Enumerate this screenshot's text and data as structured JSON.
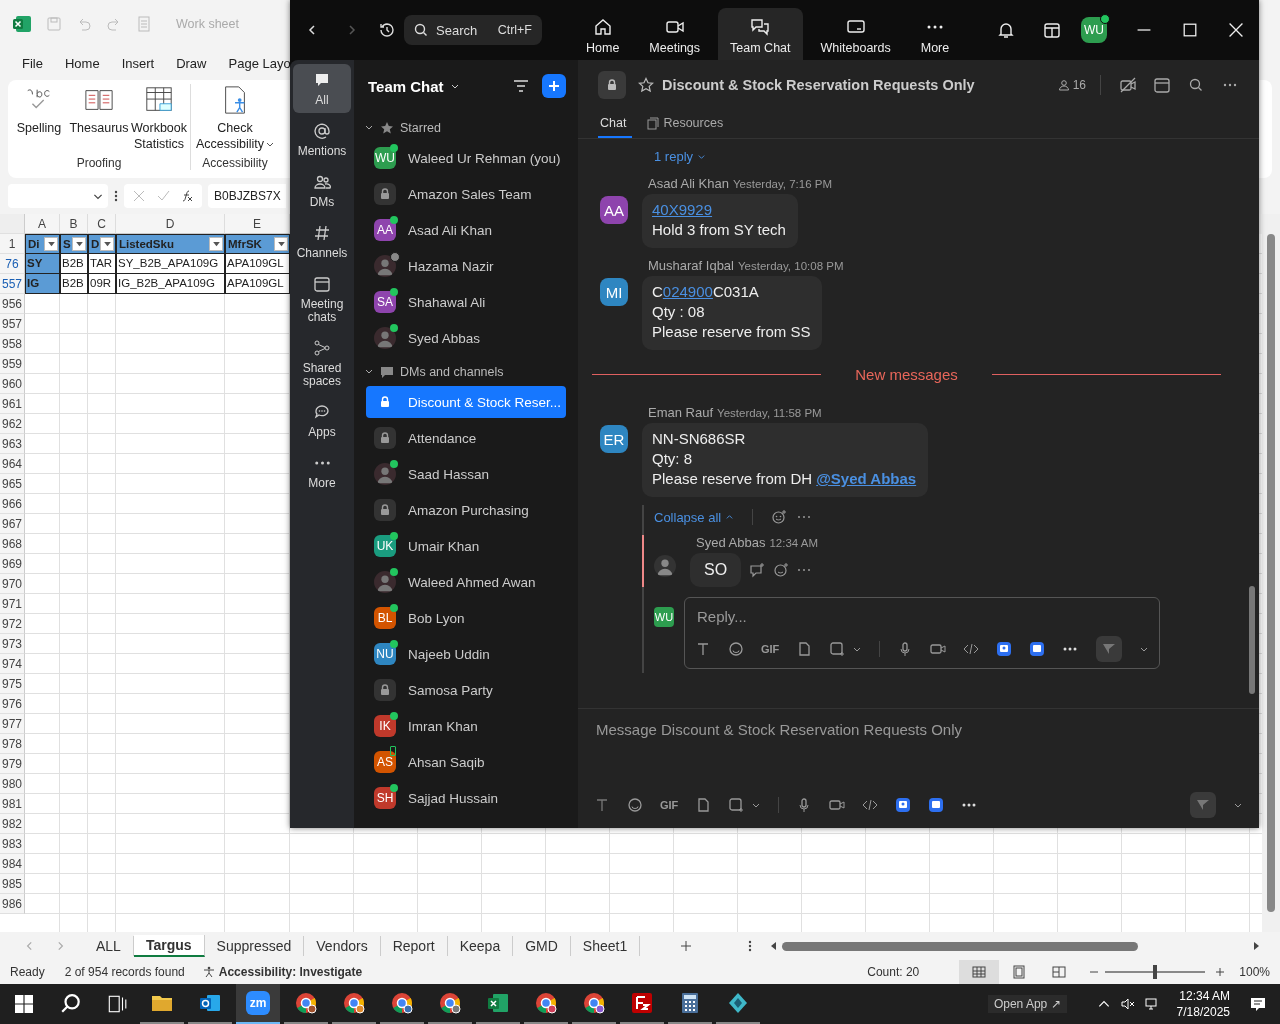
{
  "excel": {
    "title": "Work sheet",
    "menu": [
      "File",
      "Home",
      "Insert",
      "Draw",
      "Page Layo"
    ],
    "ribbon": [
      {
        "label": "Proofing",
        "buttons": [
          {
            "kind": "spelling",
            "label": "Spelling"
          },
          {
            "kind": "thesaurus",
            "label": "Thesaurus"
          },
          {
            "kind": "statistics",
            "label": "Workbook Statistics"
          }
        ]
      },
      {
        "label": "Accessibility",
        "buttons": [
          {
            "kind": "accessibility",
            "label": "Check Accessibility"
          }
        ]
      }
    ],
    "formula_value": "B0BJZBS7X",
    "columns": [
      "A",
      "B",
      "C",
      "D",
      "E"
    ],
    "header_row": {
      "number": "1",
      "cells": [
        "Di",
        "S",
        "D",
        "ListedSku",
        "MfrSK"
      ]
    },
    "rows": [
      {
        "number": "76",
        "cells": [
          "SY",
          "B2B",
          "TAR",
          "SY_B2B_APA109G",
          "APA109GL"
        ]
      },
      {
        "number": "557",
        "cells": [
          "IG",
          "B2B",
          "09R",
          "IG_B2B_APA109G",
          "APA109GL"
        ]
      }
    ],
    "empty_rows": [
      "956",
      "957",
      "958",
      "959",
      "960",
      "961",
      "962",
      "963",
      "964",
      "965",
      "966",
      "967",
      "968",
      "969",
      "970",
      "971",
      "972",
      "973",
      "974",
      "975",
      "976",
      "977",
      "978",
      "979",
      "980",
      "981",
      "982",
      "983",
      "984",
      "985",
      "986"
    ],
    "sheet_tabs": [
      {
        "label": "ALL",
        "selected": false
      },
      {
        "label": "Targus",
        "selected": true
      },
      {
        "label": "Suppressed",
        "selected": false
      },
      {
        "label": "Vendors",
        "selected": false
      },
      {
        "label": "Report",
        "selected": false
      },
      {
        "label": "Keepa",
        "selected": false
      },
      {
        "label": "GMD",
        "selected": false
      },
      {
        "label": "Sheet1",
        "selected": false
      }
    ],
    "status": {
      "ready": "Ready",
      "records": "2 of 954 records found",
      "accessibility": "Accessibility: Investigate",
      "count": "Count: 20",
      "zoom": "100%"
    },
    "zoom_slider": {
      "level": 0.5
    }
  },
  "taskbar": {
    "apps": [
      {
        "kind": "files",
        "selected": false
      },
      {
        "kind": "outlook",
        "selected": false
      },
      {
        "kind": "zoom",
        "label": "zm",
        "selected": true
      },
      {
        "kind": "browser",
        "color": "#a0522d",
        "selected": false
      },
      {
        "kind": "browser",
        "color": "#e08a2b",
        "selected": false
      },
      {
        "kind": "browser",
        "color": "#3a6fb0",
        "selected": false
      },
      {
        "kind": "browser",
        "color": "#7a7a7a",
        "selected": false
      },
      {
        "kind": "excel",
        "selected": false
      },
      {
        "kind": "browser",
        "color": "#d0405a",
        "selected": false
      },
      {
        "kind": "browser",
        "color": "#8a5ad0",
        "selected": false
      },
      {
        "kind": "filezilla",
        "selected": false
      },
      {
        "kind": "calculator",
        "selected": false
      },
      {
        "kind": "diamond",
        "selected": false
      }
    ],
    "open_app": "Open App ↗",
    "time": "12:34 AM",
    "date": "7/18/2025"
  },
  "zoom": {
    "search": {
      "placeholder": "Search",
      "shortcut": "Ctrl+F"
    },
    "nav": [
      {
        "kind": "home",
        "label": "Home",
        "selected": false
      },
      {
        "kind": "meetings",
        "label": "Meetings",
        "selected": false
      },
      {
        "kind": "chat",
        "label": "Team Chat",
        "selected": true
      },
      {
        "kind": "whiteboards",
        "label": "Whiteboards",
        "selected": false
      },
      {
        "kind": "more",
        "label": "More",
        "selected": false
      }
    ],
    "user_initials": "WU",
    "rail": [
      {
        "kind": "all",
        "label": "All",
        "selected": true
      },
      {
        "kind": "mentions",
        "label": "Mentions",
        "selected": false
      },
      {
        "kind": "dms",
        "label": "DMs",
        "selected": false
      },
      {
        "kind": "channels",
        "label": "Channels",
        "selected": false
      },
      {
        "kind": "meeting",
        "label": "Meeting chats",
        "selected": false
      },
      {
        "kind": "shared",
        "label": "Shared spaces",
        "selected": false
      },
      {
        "kind": "apps",
        "label": "Apps",
        "selected": false
      },
      {
        "kind": "more",
        "label": "More",
        "selected": false
      }
    ],
    "list_title": "Team Chat",
    "sections": [
      {
        "kind": "starred",
        "label": "Starred",
        "expanded": true,
        "items": [
          {
            "name": "Waleed Ur Rehman (you)",
            "kind": "initials",
            "initials": "WU",
            "color": "#2d9d4f",
            "status": {
              "kind": "online"
            },
            "selected": false
          },
          {
            "name": "Amazon Sales Team",
            "kind": "lock",
            "selected": false
          },
          {
            "name": "Asad Ali Khan",
            "kind": "initials",
            "initials": "AA",
            "color": "#8e44ad",
            "status": {
              "kind": "online"
            },
            "selected": false
          },
          {
            "name": "Hazama Nazir",
            "kind": "photo",
            "status": {
              "kind": "away"
            },
            "selected": false
          },
          {
            "name": "Shahawal Ali",
            "kind": "initials",
            "initials": "SA",
            "color": "#8e44ad",
            "status": {
              "kind": "online"
            },
            "selected": false
          },
          {
            "name": "Syed Abbas",
            "kind": "photo",
            "status": {
              "kind": "online"
            },
            "selected": false
          }
        ]
      },
      {
        "kind": "dms",
        "label": "DMs and channels",
        "expanded": true,
        "items": [
          {
            "name": "Discount & Stock Reser...",
            "kind": "lock",
            "selected": true
          },
          {
            "name": "Attendance",
            "kind": "lock",
            "selected": false
          },
          {
            "name": "Saad Hassan",
            "kind": "photo",
            "status": {
              "kind": "online"
            },
            "selected": false
          },
          {
            "name": "Amazon Purchasing",
            "kind": "lock",
            "selected": false
          },
          {
            "name": "Umair Khan",
            "kind": "initials",
            "initials": "UK",
            "color": "#1a9c7f",
            "status": {
              "kind": "online"
            },
            "selected": false
          },
          {
            "name": "Waleed Ahmed Awan",
            "kind": "photo",
            "status": {
              "kind": "online"
            },
            "selected": false
          },
          {
            "name": "Bob Lyon",
            "kind": "initials",
            "initials": "BL",
            "color": "#d35400",
            "status": {
              "kind": "online"
            },
            "selected": false
          },
          {
            "name": "Najeeb Uddin",
            "kind": "initials",
            "initials": "NU",
            "color": "#2e86c1",
            "status": {
              "kind": "online"
            },
            "selected": false
          },
          {
            "name": "Samosa Party",
            "kind": "lock",
            "selected": false
          },
          {
            "name": "Imran Khan",
            "kind": "initials",
            "initials": "IK",
            "color": "#c0392b",
            "status": {
              "kind": "online"
            },
            "selected": false
          },
          {
            "name": "Ahsan Saqib",
            "kind": "initials",
            "initials": "AS",
            "color": "#d35400",
            "status": {
              "kind": "mobile"
            },
            "selected": false
          },
          {
            "name": "Sajjad Hussain",
            "kind": "initials",
            "initials": "SH",
            "color": "#c0392b",
            "status": {
              "kind": "online"
            },
            "selected": false
          }
        ]
      }
    ],
    "channel": {
      "title": "Discount & Stock Reservation Requests Only",
      "members": "16",
      "tabs": [
        {
          "label": "Chat",
          "selected": true
        },
        {
          "label": "Resources",
          "selected": false
        }
      ]
    },
    "reply_link": "1 reply",
    "messages": [
      {
        "kind": "message",
        "initials": "AA",
        "color": "#8e44ad",
        "sender": "Asad Ali Khan",
        "time": "Yesterday, 7:16 PM",
        "lines": [
          [
            {
              "kind": "link",
              "text": "40X9929"
            }
          ],
          [
            {
              "kind": "text",
              "text": "Hold 3 from SY tech"
            }
          ]
        ]
      },
      {
        "kind": "message",
        "initials": "MI",
        "color": "#2e86c1",
        "sender": "Musharaf Iqbal",
        "time": "Yesterday, 10:08 PM",
        "lines": [
          [
            {
              "kind": "text",
              "text": "C"
            },
            {
              "kind": "link",
              "text": "024900"
            },
            {
              "kind": "text",
              "text": "C031A"
            }
          ],
          [
            {
              "kind": "text",
              "text": "Qty : 08"
            }
          ],
          [
            {
              "kind": "text",
              "text": "Please reserve from SS"
            }
          ]
        ]
      },
      {
        "kind": "divider",
        "text": "New messages"
      },
      {
        "kind": "message",
        "initials": "ER",
        "color": "#2e86c1",
        "sender": "Eman Rauf",
        "time": "Yesterday, 11:58 PM",
        "lines": [
          [
            {
              "kind": "text",
              "text": "NN-SN686SR"
            }
          ],
          [
            {
              "kind": "text",
              "text": "Qty: 8"
            }
          ],
          [
            {
              "kind": "text",
              "text": "Please reserve from DH "
            },
            {
              "kind": "mention",
              "text": "@Syed Abbas"
            }
          ]
        ],
        "thread": {
          "collapse": "Collapse all",
          "replies": [
            {
              "sender": "Syed Abbas",
              "time": "12:34 AM",
              "text": "SO"
            }
          ],
          "reply_box": {
            "initials": "WU",
            "placeholder": "Reply...",
            "gif": "GIF"
          }
        }
      }
    ],
    "composer": {
      "placeholder": "Message Discount & Stock Reservation Requests Only",
      "gif": "GIF"
    }
  }
}
